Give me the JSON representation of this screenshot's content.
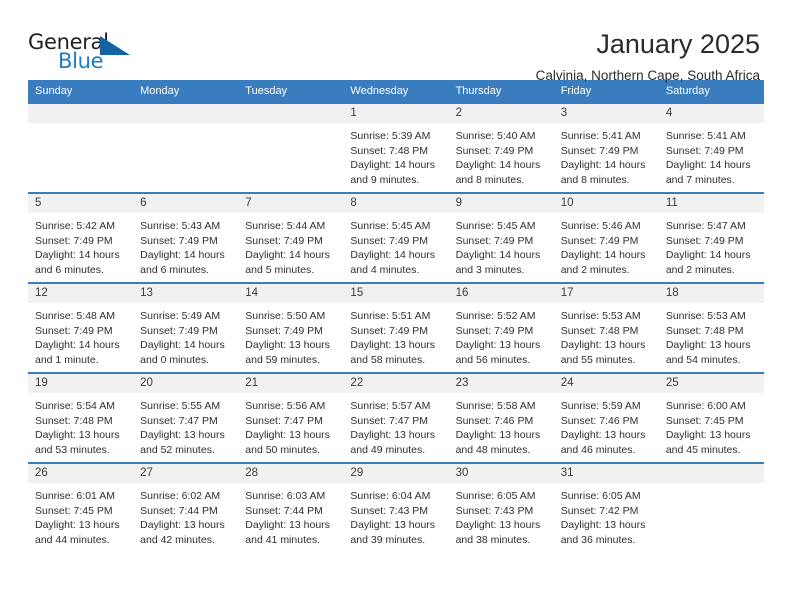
{
  "logo": {
    "word_top": "General",
    "word_bottom": "Blue",
    "accent_color": "#1464a5",
    "blue_text_color": "#1d7cc4"
  },
  "header": {
    "title": "January 2025",
    "subtitle": "Calvinia, Northern Cape, South Africa"
  },
  "calendar": {
    "header_bg": "#3a7dbf",
    "daynum_bg": "#f1f1f1",
    "weekday_headers": [
      "Sunday",
      "Monday",
      "Tuesday",
      "Wednesday",
      "Thursday",
      "Friday",
      "Saturday"
    ],
    "labels": {
      "sunrise": "Sunrise:",
      "sunset": "Sunset:",
      "daylight": "Daylight:"
    },
    "weeks": [
      [
        {
          "day": "",
          "sunrise": "",
          "sunset": "",
          "daylight": ""
        },
        {
          "day": "",
          "sunrise": "",
          "sunset": "",
          "daylight": ""
        },
        {
          "day": "",
          "sunrise": "",
          "sunset": "",
          "daylight": ""
        },
        {
          "day": "1",
          "sunrise": "Sunrise: 5:39 AM",
          "sunset": "Sunset: 7:48 PM",
          "daylight": "Daylight: 14 hours and 9 minutes."
        },
        {
          "day": "2",
          "sunrise": "Sunrise: 5:40 AM",
          "sunset": "Sunset: 7:49 PM",
          "daylight": "Daylight: 14 hours and 8 minutes."
        },
        {
          "day": "3",
          "sunrise": "Sunrise: 5:41 AM",
          "sunset": "Sunset: 7:49 PM",
          "daylight": "Daylight: 14 hours and 8 minutes."
        },
        {
          "day": "4",
          "sunrise": "Sunrise: 5:41 AM",
          "sunset": "Sunset: 7:49 PM",
          "daylight": "Daylight: 14 hours and 7 minutes."
        }
      ],
      [
        {
          "day": "5",
          "sunrise": "Sunrise: 5:42 AM",
          "sunset": "Sunset: 7:49 PM",
          "daylight": "Daylight: 14 hours and 6 minutes."
        },
        {
          "day": "6",
          "sunrise": "Sunrise: 5:43 AM",
          "sunset": "Sunset: 7:49 PM",
          "daylight": "Daylight: 14 hours and 6 minutes."
        },
        {
          "day": "7",
          "sunrise": "Sunrise: 5:44 AM",
          "sunset": "Sunset: 7:49 PM",
          "daylight": "Daylight: 14 hours and 5 minutes."
        },
        {
          "day": "8",
          "sunrise": "Sunrise: 5:45 AM",
          "sunset": "Sunset: 7:49 PM",
          "daylight": "Daylight: 14 hours and 4 minutes."
        },
        {
          "day": "9",
          "sunrise": "Sunrise: 5:45 AM",
          "sunset": "Sunset: 7:49 PM",
          "daylight": "Daylight: 14 hours and 3 minutes."
        },
        {
          "day": "10",
          "sunrise": "Sunrise: 5:46 AM",
          "sunset": "Sunset: 7:49 PM",
          "daylight": "Daylight: 14 hours and 2 minutes."
        },
        {
          "day": "11",
          "sunrise": "Sunrise: 5:47 AM",
          "sunset": "Sunset: 7:49 PM",
          "daylight": "Daylight: 14 hours and 2 minutes."
        }
      ],
      [
        {
          "day": "12",
          "sunrise": "Sunrise: 5:48 AM",
          "sunset": "Sunset: 7:49 PM",
          "daylight": "Daylight: 14 hours and 1 minute."
        },
        {
          "day": "13",
          "sunrise": "Sunrise: 5:49 AM",
          "sunset": "Sunset: 7:49 PM",
          "daylight": "Daylight: 14 hours and 0 minutes."
        },
        {
          "day": "14",
          "sunrise": "Sunrise: 5:50 AM",
          "sunset": "Sunset: 7:49 PM",
          "daylight": "Daylight: 13 hours and 59 minutes."
        },
        {
          "day": "15",
          "sunrise": "Sunrise: 5:51 AM",
          "sunset": "Sunset: 7:49 PM",
          "daylight": "Daylight: 13 hours and 58 minutes."
        },
        {
          "day": "16",
          "sunrise": "Sunrise: 5:52 AM",
          "sunset": "Sunset: 7:49 PM",
          "daylight": "Daylight: 13 hours and 56 minutes."
        },
        {
          "day": "17",
          "sunrise": "Sunrise: 5:53 AM",
          "sunset": "Sunset: 7:48 PM",
          "daylight": "Daylight: 13 hours and 55 minutes."
        },
        {
          "day": "18",
          "sunrise": "Sunrise: 5:53 AM",
          "sunset": "Sunset: 7:48 PM",
          "daylight": "Daylight: 13 hours and 54 minutes."
        }
      ],
      [
        {
          "day": "19",
          "sunrise": "Sunrise: 5:54 AM",
          "sunset": "Sunset: 7:48 PM",
          "daylight": "Daylight: 13 hours and 53 minutes."
        },
        {
          "day": "20",
          "sunrise": "Sunrise: 5:55 AM",
          "sunset": "Sunset: 7:47 PM",
          "daylight": "Daylight: 13 hours and 52 minutes."
        },
        {
          "day": "21",
          "sunrise": "Sunrise: 5:56 AM",
          "sunset": "Sunset: 7:47 PM",
          "daylight": "Daylight: 13 hours and 50 minutes."
        },
        {
          "day": "22",
          "sunrise": "Sunrise: 5:57 AM",
          "sunset": "Sunset: 7:47 PM",
          "daylight": "Daylight: 13 hours and 49 minutes."
        },
        {
          "day": "23",
          "sunrise": "Sunrise: 5:58 AM",
          "sunset": "Sunset: 7:46 PM",
          "daylight": "Daylight: 13 hours and 48 minutes."
        },
        {
          "day": "24",
          "sunrise": "Sunrise: 5:59 AM",
          "sunset": "Sunset: 7:46 PM",
          "daylight": "Daylight: 13 hours and 46 minutes."
        },
        {
          "day": "25",
          "sunrise": "Sunrise: 6:00 AM",
          "sunset": "Sunset: 7:45 PM",
          "daylight": "Daylight: 13 hours and 45 minutes."
        }
      ],
      [
        {
          "day": "26",
          "sunrise": "Sunrise: 6:01 AM",
          "sunset": "Sunset: 7:45 PM",
          "daylight": "Daylight: 13 hours and 44 minutes."
        },
        {
          "day": "27",
          "sunrise": "Sunrise: 6:02 AM",
          "sunset": "Sunset: 7:44 PM",
          "daylight": "Daylight: 13 hours and 42 minutes."
        },
        {
          "day": "28",
          "sunrise": "Sunrise: 6:03 AM",
          "sunset": "Sunset: 7:44 PM",
          "daylight": "Daylight: 13 hours and 41 minutes."
        },
        {
          "day": "29",
          "sunrise": "Sunrise: 6:04 AM",
          "sunset": "Sunset: 7:43 PM",
          "daylight": "Daylight: 13 hours and 39 minutes."
        },
        {
          "day": "30",
          "sunrise": "Sunrise: 6:05 AM",
          "sunset": "Sunset: 7:43 PM",
          "daylight": "Daylight: 13 hours and 38 minutes."
        },
        {
          "day": "31",
          "sunrise": "Sunrise: 6:05 AM",
          "sunset": "Sunset: 7:42 PM",
          "daylight": "Daylight: 13 hours and 36 minutes."
        },
        {
          "day": "",
          "sunrise": "",
          "sunset": "",
          "daylight": ""
        }
      ]
    ]
  }
}
